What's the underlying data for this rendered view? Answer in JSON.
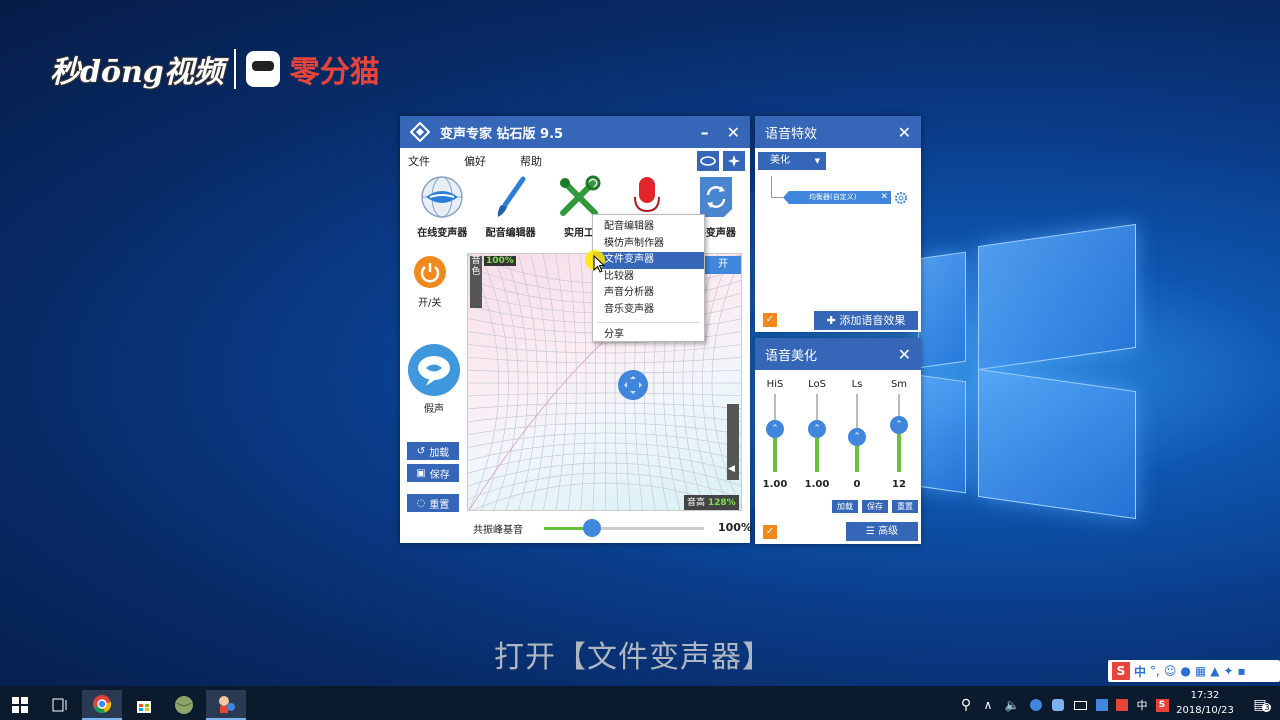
{
  "watermark": {
    "brand_left": "秒dōng视频",
    "brand_right": "零分猫"
  },
  "main_window": {
    "title": "变声专家  钻石版  9.5",
    "minimize": "–",
    "close": "✕",
    "menu": [
      "文件",
      "偏好",
      "帮助"
    ],
    "tools": [
      {
        "label": "在线变声器",
        "icon": "lips-globe-icon"
      },
      {
        "label": "配音编辑器",
        "icon": "brush-icon"
      },
      {
        "label": "实用工",
        "icon": "tools-icon"
      },
      {
        "label": "",
        "icon": "microphone-icon"
      },
      {
        "label": "件变声器",
        "icon": "file-refresh-icon"
      }
    ],
    "power_label": "开/关",
    "fake_label": "假声",
    "load_label": "加载",
    "save_label": "保存",
    "reset_label": "重置",
    "timbre_label": "音色",
    "timbre_value": "100%",
    "pitch_label": "音高",
    "pitch_value": "128%",
    "open_tab": "开",
    "resonance_label": "共振峰基音",
    "resonance_value": "100%",
    "resonance_fraction": 0.3
  },
  "context_menu": {
    "items": [
      "配音编辑器",
      "模仿声制作器",
      "文件变声器",
      "比较器",
      "声音分析器",
      "音乐变声器"
    ],
    "selected": "文件变声器",
    "share": "分享"
  },
  "fx_window": {
    "title": "语音特效",
    "close": "✕",
    "dropdown": "美化",
    "effect_item": "均衡器(自定义)",
    "add_effect": "添加语音效果"
  },
  "beauty_window": {
    "title": "语音美化",
    "close": "✕",
    "faders": [
      {
        "name": "HiS",
        "value": "1.00",
        "level": 0.45
      },
      {
        "name": "LoS",
        "value": "1.00",
        "level": 0.45
      },
      {
        "name": "Ls",
        "value": "0",
        "level": 0.55
      },
      {
        "name": "Sm",
        "value": "12",
        "level": 0.4
      }
    ],
    "load": "加载",
    "save": "保存",
    "reset": "重置",
    "advanced": "高级"
  },
  "subtitle": "打开【文件变声器】",
  "taskbar": {
    "time": "17:32",
    "date": "2018/10/23",
    "ime_lang": "中",
    "notifications": "3"
  },
  "colors": {
    "accent": "#3566b8",
    "knob": "#3f86dc",
    "power": "#f08a1f",
    "level": "#66c23a"
  }
}
